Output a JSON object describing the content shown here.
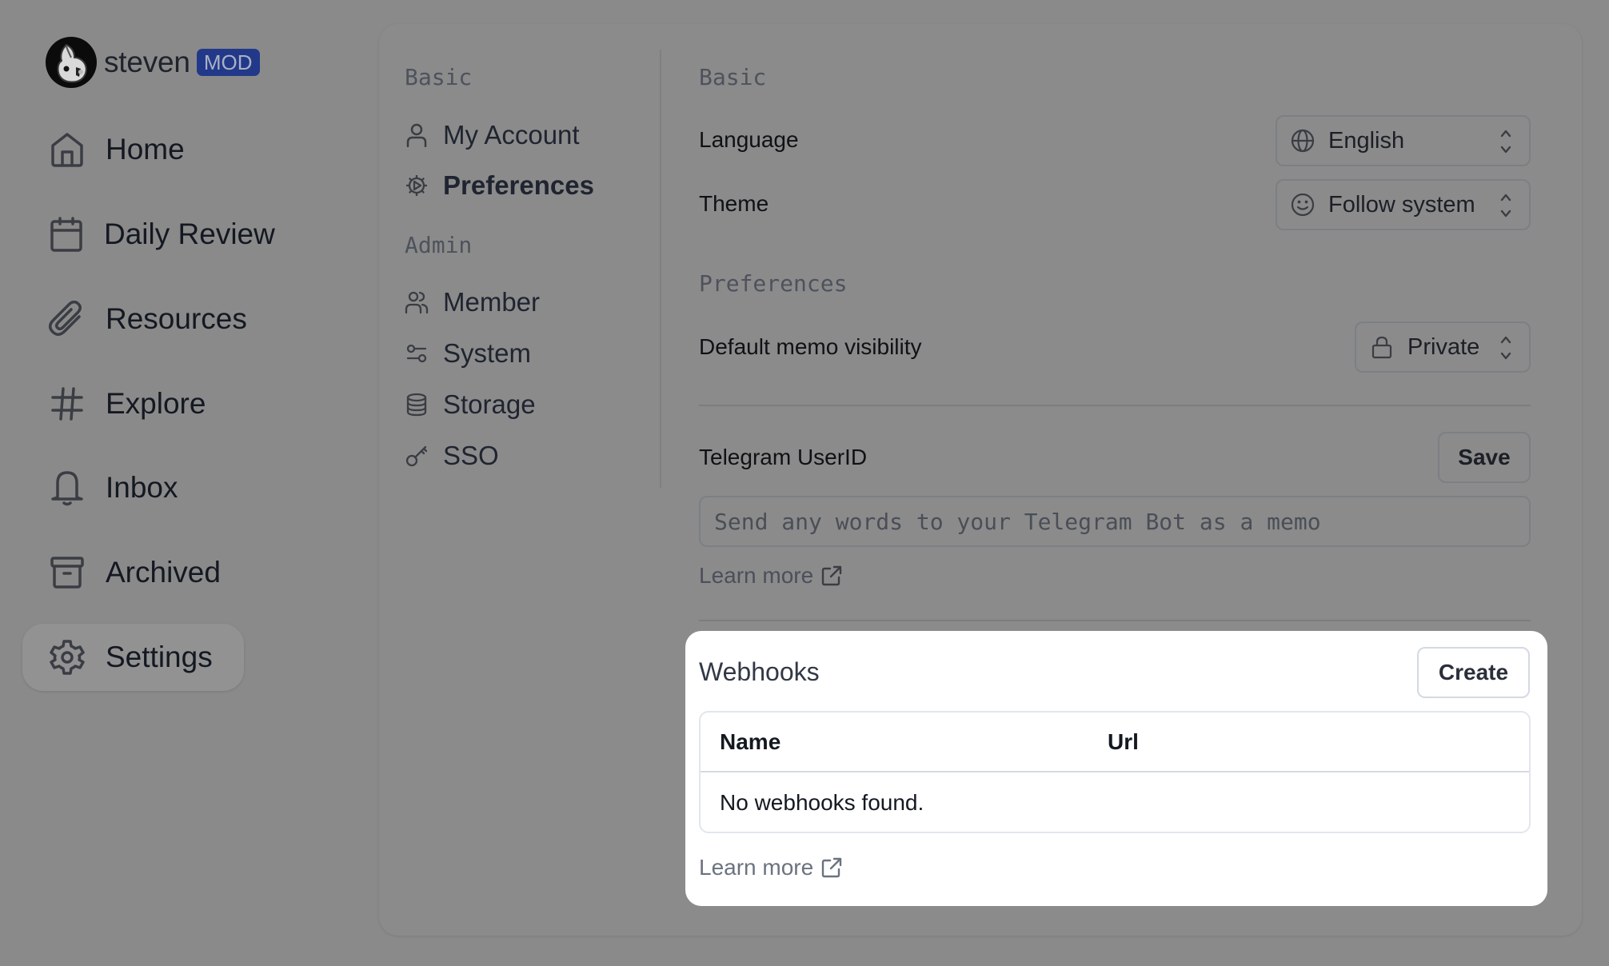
{
  "user": {
    "name": "steven",
    "role_badge": "MOD",
    "avatar_icon": "cockatiel-avatar-icon"
  },
  "sidebar": {
    "items": [
      {
        "label": "Home",
        "icon": "home-icon",
        "active": false
      },
      {
        "label": "Daily Review",
        "icon": "calendar-icon",
        "active": false
      },
      {
        "label": "Resources",
        "icon": "paperclip-icon",
        "active": false
      },
      {
        "label": "Explore",
        "icon": "hash-icon",
        "active": false
      },
      {
        "label": "Inbox",
        "icon": "bell-icon",
        "active": false
      },
      {
        "label": "Archived",
        "icon": "archive-icon",
        "active": false
      },
      {
        "label": "Settings",
        "icon": "gear-icon",
        "active": true
      }
    ]
  },
  "settings_nav": {
    "basic_label": "Basic",
    "admin_label": "Admin",
    "basic_items": [
      {
        "label": "My Account",
        "icon": "user-icon",
        "active": false
      },
      {
        "label": "Preferences",
        "icon": "cog-play-icon",
        "active": true
      }
    ],
    "admin_items": [
      {
        "label": "Member",
        "icon": "users-icon",
        "active": false
      },
      {
        "label": "System",
        "icon": "sliders-icon",
        "active": false
      },
      {
        "label": "Storage",
        "icon": "database-icon",
        "active": false
      },
      {
        "label": "SSO",
        "icon": "key-icon",
        "active": false
      }
    ]
  },
  "content": {
    "basic_section": "Basic",
    "language": {
      "label": "Language",
      "value": "English",
      "icon": "globe-icon"
    },
    "theme": {
      "label": "Theme",
      "value": "Follow system",
      "icon": "smile-icon"
    },
    "preferences_section": "Preferences",
    "visibility": {
      "label": "Default memo visibility",
      "value": "Private",
      "icon": "lock-icon"
    },
    "telegram": {
      "label": "Telegram UserID",
      "save_label": "Save",
      "value": "",
      "placeholder": "Send any words to your Telegram Bot as a memo",
      "learn_more": "Learn more"
    },
    "webhooks": {
      "title": "Webhooks",
      "create_label": "Create",
      "columns": [
        "Name",
        "Url"
      ],
      "rows": [],
      "empty_text": "No webhooks found.",
      "learn_more": "Learn more"
    }
  },
  "colors": {
    "overlay_background": "#8a8a8a",
    "badge_background": "#22398a",
    "highlight_card": "#ffffff"
  }
}
